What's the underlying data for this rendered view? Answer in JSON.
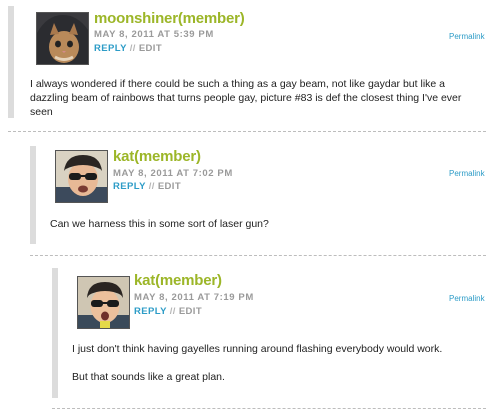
{
  "comments": [
    {
      "author": "moonshiner(member)",
      "date": "MAY 8, 2011 AT 5:39 PM",
      "reply": "REPLY",
      "separator": "//",
      "edit": "EDIT",
      "permalink": "Permalink",
      "avatar_icon": "cat-in-hoodie-avatar",
      "body": [
        "I always wondered if there could be such a thing as a gay beam, not like gaydar but like a dazzling beam of rainbows that turns people gay, picture #83 is def the closest thing I've ever seen"
      ]
    },
    {
      "author": "kat(member)",
      "date": "MAY 8, 2011 AT 7:02 PM",
      "reply": "REPLY",
      "separator": "//",
      "edit": "EDIT",
      "permalink": "Permalink",
      "avatar_icon": "person-sunglasses-avatar",
      "body": [
        "Can we harness this in some sort of laser gun?"
      ]
    },
    {
      "author": "kat(member)",
      "date": "MAY 8, 2011 AT 7:19 PM",
      "reply": "REPLY",
      "separator": "//",
      "edit": "EDIT",
      "permalink": "Permalink",
      "avatar_icon": "person-sunglasses-avatar",
      "body": [
        "I just don't think having gayelles running around flashing everybody would work.",
        "But that sounds like a great plan."
      ]
    }
  ],
  "colors": {
    "author": "#9cb628",
    "reply": "#2d9cc7",
    "meta": "#9a9a9a",
    "bar": "#dcdcdc"
  }
}
